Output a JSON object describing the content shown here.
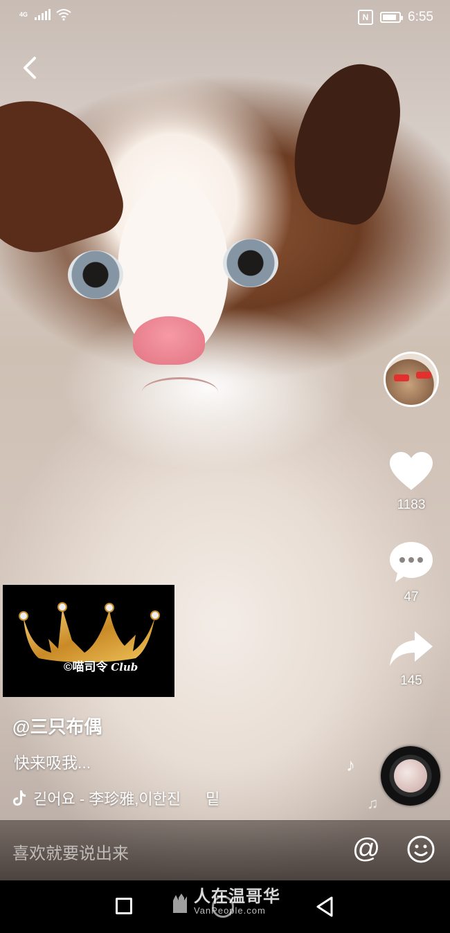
{
  "status_bar": {
    "network": "4G",
    "time": "6:55",
    "nfc_label": "N",
    "battery_level": 0.85
  },
  "video": {
    "username": "@三只布偶",
    "caption": "快来吸我...",
    "music": "긷어요 - 李珍雅,이한진",
    "music_extra": "밑",
    "logo_text": "©喵司令",
    "logo_club": "Club"
  },
  "actions": {
    "likes": "1183",
    "comments": "47",
    "shares": "145"
  },
  "comment_bar": {
    "placeholder": "喜欢就要说出来",
    "at_symbol": "@"
  },
  "watermark": {
    "title": "人在温哥华",
    "subtitle": "VanPeople.com"
  },
  "icons": {
    "back": "chevron-left-icon",
    "like": "heart-icon",
    "comment": "speech-bubble-icon",
    "share": "share-arrow-icon",
    "music": "music-note-icon",
    "emoji": "smiley-icon"
  },
  "colors": {
    "accent_white": "#ffffff",
    "nose_pink": "#e27482",
    "logo_gold": "#d4a23c"
  }
}
